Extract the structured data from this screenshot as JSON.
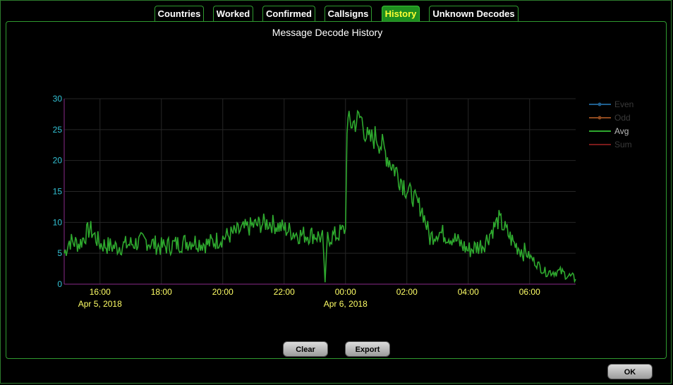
{
  "tabs": [
    {
      "label": "Countries",
      "active": false
    },
    {
      "label": "Worked",
      "active": false
    },
    {
      "label": "Confirmed",
      "active": false
    },
    {
      "label": "Callsigns",
      "active": false
    },
    {
      "label": "History",
      "active": true
    },
    {
      "label": "Unknown Decodes",
      "active": false
    }
  ],
  "buttons": {
    "clear": "Clear",
    "export": "Export",
    "ok": "OK"
  },
  "colors": {
    "accent": "#2f9a2f",
    "active_tab_text": "#ffff33",
    "y_ticks": "#33c3d6",
    "x_ticks": "#ffff66"
  },
  "chart_data": {
    "type": "line",
    "title": "Message Decode History",
    "xlabel": "",
    "ylabel": "",
    "xlim": [
      "2018-04-05 14:50",
      "2018-04-06 07:30"
    ],
    "ylim": [
      0,
      30
    ],
    "grid": true,
    "legend_position": "right",
    "y_ticks": [
      "0",
      "5",
      "10",
      "15",
      "20",
      "25",
      "30"
    ],
    "x_ticks": [
      {
        "t": "2018-04-05 16:00",
        "label": "16:00",
        "date": "Apr 5, 2018"
      },
      {
        "t": "2018-04-05 18:00",
        "label": "18:00",
        "date": ""
      },
      {
        "t": "2018-04-05 20:00",
        "label": "20:00",
        "date": ""
      },
      {
        "t": "2018-04-05 22:00",
        "label": "22:00",
        "date": ""
      },
      {
        "t": "2018-04-06 00:00",
        "label": "00:00",
        "date": "Apr 6, 2018"
      },
      {
        "t": "2018-04-06 02:00",
        "label": "02:00",
        "date": ""
      },
      {
        "t": "2018-04-06 04:00",
        "label": "04:00",
        "date": ""
      },
      {
        "t": "2018-04-06 06:00",
        "label": "06:00",
        "date": ""
      }
    ],
    "series": [
      {
        "name": "Even",
        "color": "#1f5f8f",
        "visible": false,
        "points": []
      },
      {
        "name": "Odd",
        "color": "#8f4a1f",
        "visible": false,
        "points": []
      },
      {
        "name": "Avg",
        "color": "#2ea82e",
        "visible": true,
        "points": [
          [
            "2018-04-05 14:50",
            5.0
          ],
          [
            "2018-04-05 15:00",
            7.0
          ],
          [
            "2018-04-05 15:20",
            6.5
          ],
          [
            "2018-04-05 15:40",
            9.0
          ],
          [
            "2018-04-05 16:00",
            6.5
          ],
          [
            "2018-04-05 16:30",
            6.0
          ],
          [
            "2018-04-05 17:00",
            6.5
          ],
          [
            "2018-04-05 17:30",
            7.0
          ],
          [
            "2018-04-05 18:00",
            6.0
          ],
          [
            "2018-04-05 18:30",
            6.5
          ],
          [
            "2018-04-05 19:00",
            7.0
          ],
          [
            "2018-04-05 19:30",
            6.5
          ],
          [
            "2018-04-05 20:00",
            7.5
          ],
          [
            "2018-04-05 20:30",
            8.5
          ],
          [
            "2018-04-05 21:00",
            9.5
          ],
          [
            "2018-04-05 21:30",
            10.0
          ],
          [
            "2018-04-05 22:00",
            9.0
          ],
          [
            "2018-04-05 22:30",
            8.0
          ],
          [
            "2018-04-05 23:00",
            8.0
          ],
          [
            "2018-04-05 23:15",
            7.5
          ],
          [
            "2018-04-05 23:20",
            0.5
          ],
          [
            "2018-04-05 23:25",
            7.5
          ],
          [
            "2018-04-05 23:45",
            8.0
          ],
          [
            "2018-04-06 00:00",
            9.0
          ],
          [
            "2018-04-06 00:03",
            26.0
          ],
          [
            "2018-04-06 00:15",
            26.0
          ],
          [
            "2018-04-06 00:30",
            27.0
          ],
          [
            "2018-04-06 00:45",
            23.0
          ],
          [
            "2018-04-06 01:00",
            24.0
          ],
          [
            "2018-04-06 01:30",
            19.5
          ],
          [
            "2018-04-06 02:00",
            15.5
          ],
          [
            "2018-04-06 02:30",
            12.0
          ],
          [
            "2018-04-06 02:45",
            7.5
          ],
          [
            "2018-04-06 03:00",
            8.5
          ],
          [
            "2018-04-06 03:30",
            7.5
          ],
          [
            "2018-04-06 04:00",
            5.5
          ],
          [
            "2018-04-06 04:30",
            6.5
          ],
          [
            "2018-04-06 05:00",
            10.5
          ],
          [
            "2018-04-06 05:30",
            6.5
          ],
          [
            "2018-04-06 06:00",
            4.5
          ],
          [
            "2018-04-06 06:30",
            2.0
          ],
          [
            "2018-04-06 07:00",
            2.0
          ],
          [
            "2018-04-06 07:30",
            0.8
          ]
        ]
      },
      {
        "name": "Sum",
        "color": "#7a1a1a",
        "visible": false,
        "points": []
      }
    ]
  }
}
